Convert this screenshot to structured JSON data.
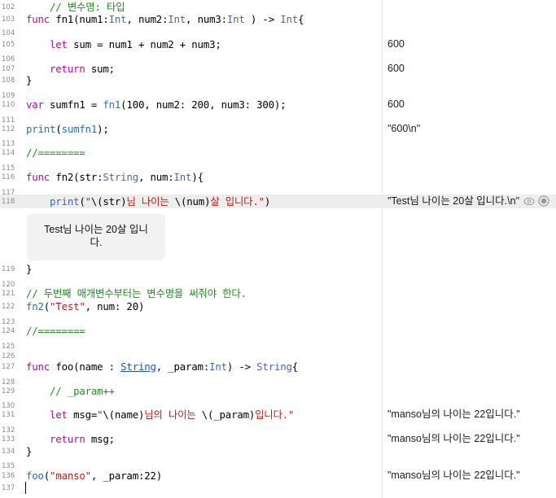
{
  "code_lines": [
    {
      "n": "102",
      "parts": [
        {
          "t": "    // 변수명: 타입",
          "c": "com"
        }
      ]
    },
    {
      "n": "103",
      "parts": [
        {
          "t": "func ",
          "c": "kw"
        },
        {
          "t": "fn1(num1:"
        },
        {
          "t": "Int",
          "c": "ty"
        },
        {
          "t": ", num2:"
        },
        {
          "t": "Int",
          "c": "ty"
        },
        {
          "t": ", num3:"
        },
        {
          "t": "Int",
          "c": "ty"
        },
        {
          "t": " ) -> "
        },
        {
          "t": "Int",
          "c": "ty"
        },
        {
          "t": "{"
        }
      ]
    },
    {
      "n": "104",
      "parts": []
    },
    {
      "n": "105",
      "parts": [
        {
          "t": "    let ",
          "c": "kw"
        },
        {
          "t": "sum = num1 + num2 + num3;"
        }
      ]
    },
    {
      "n": "106",
      "parts": []
    },
    {
      "n": "107",
      "parts": [
        {
          "t": "    return ",
          "c": "kw"
        },
        {
          "t": "sum;"
        }
      ]
    },
    {
      "n": "108",
      "parts": [
        {
          "t": "}"
        }
      ]
    },
    {
      "n": "109",
      "parts": []
    },
    {
      "n": "110",
      "parts": [
        {
          "t": "var ",
          "c": "kw"
        },
        {
          "t": "sumfn1 = "
        },
        {
          "t": "fn1",
          "c": "fn"
        },
        {
          "t": "(100, num2: 200, num3: 300);"
        }
      ]
    },
    {
      "n": "111",
      "parts": []
    },
    {
      "n": "112",
      "parts": [
        {
          "t": "print",
          "c": "fn"
        },
        {
          "t": "("
        },
        {
          "t": "sumfn1",
          "c": "fn"
        },
        {
          "t": ");"
        }
      ]
    },
    {
      "n": "113",
      "parts": []
    },
    {
      "n": "114",
      "parts": [
        {
          "t": "//========",
          "c": "com"
        }
      ]
    },
    {
      "n": "115",
      "parts": []
    },
    {
      "n": "116",
      "parts": [
        {
          "t": "func ",
          "c": "kw"
        },
        {
          "t": "fn2(str:"
        },
        {
          "t": "String",
          "c": "ty"
        },
        {
          "t": ", num:"
        },
        {
          "t": "Int",
          "c": "ty"
        },
        {
          "t": "){"
        }
      ]
    },
    {
      "n": "117",
      "parts": []
    },
    {
      "n": "118",
      "parts": [
        {
          "t": "    print",
          "c": "fn"
        },
        {
          "t": "("
        },
        {
          "t": "\"",
          "c": "str"
        },
        {
          "t": "\\(str)"
        },
        {
          "t": "님 나이는 ",
          "c": "str"
        },
        {
          "t": "\\(num)"
        },
        {
          "t": "살 입니다.\"",
          "c": "str"
        },
        {
          "t": ")"
        }
      ]
    },
    {
      "n": "119",
      "parts": [
        {
          "t": "}"
        }
      ]
    },
    {
      "n": "120",
      "parts": []
    },
    {
      "n": "121",
      "parts": [
        {
          "t": "// 두번째 매개변수부터는 변수명을 써줘야 한다.",
          "c": "com"
        }
      ]
    },
    {
      "n": "122",
      "parts": [
        {
          "t": "fn2",
          "c": "fn"
        },
        {
          "t": "("
        },
        {
          "t": "\"Test\"",
          "c": "str"
        },
        {
          "t": ", num: 20)"
        }
      ]
    },
    {
      "n": "123",
      "parts": []
    },
    {
      "n": "124",
      "parts": [
        {
          "t": "//========",
          "c": "com"
        }
      ]
    },
    {
      "n": "125",
      "parts": []
    },
    {
      "n": "126",
      "parts": []
    },
    {
      "n": "127",
      "parts": [
        {
          "t": "func ",
          "c": "kw"
        },
        {
          "t": "foo(name : "
        },
        {
          "t": "String",
          "c": "lnk"
        },
        {
          "t": ", _param:"
        },
        {
          "t": "Int",
          "c": "ty"
        },
        {
          "t": ") -> "
        },
        {
          "t": "String",
          "c": "ty"
        },
        {
          "t": "{"
        }
      ]
    },
    {
      "n": "128",
      "parts": []
    },
    {
      "n": "129",
      "parts": [
        {
          "t": "    // _param++",
          "c": "com"
        }
      ]
    },
    {
      "n": "130",
      "parts": []
    },
    {
      "n": "131",
      "parts": [
        {
          "t": "    let ",
          "c": "kw"
        },
        {
          "t": "msg="
        },
        {
          "t": "\"",
          "c": "str"
        },
        {
          "t": "\\(name)"
        },
        {
          "t": "님의 나이는 ",
          "c": "str"
        },
        {
          "t": "\\(_param)"
        },
        {
          "t": "입니다.\"",
          "c": "str"
        }
      ]
    },
    {
      "n": "132",
      "parts": []
    },
    {
      "n": "133",
      "parts": [
        {
          "t": "    return ",
          "c": "kw"
        },
        {
          "t": "msg;"
        }
      ]
    },
    {
      "n": "134",
      "parts": [
        {
          "t": "}"
        }
      ]
    },
    {
      "n": "135",
      "parts": []
    },
    {
      "n": "136",
      "parts": [
        {
          "t": "foo",
          "c": "fn"
        },
        {
          "t": "("
        },
        {
          "t": "\"manso\"",
          "c": "str"
        },
        {
          "t": ", _param:22)"
        }
      ]
    },
    {
      "n": "137",
      "parts": []
    }
  ],
  "results": [
    {
      "line": "105",
      "text": "600"
    },
    {
      "line": "107",
      "text": "600"
    },
    {
      "line": "110",
      "text": "600"
    },
    {
      "line": "112",
      "text": "\"600\\n\""
    },
    {
      "line": "118",
      "text": "\"Test님 나이는 20살 입니다.\\n\""
    },
    {
      "line": "131",
      "text": "\"manso님의 나이는 22입니다.\""
    },
    {
      "line": "133",
      "text": "\"manso님의 나이는 22입니다.\""
    },
    {
      "line": "136",
      "text": "\"manso님의 나이는 22입니다.\""
    }
  ],
  "inline_result": {
    "text": "Test님 나이는 20살 입니다."
  },
  "icons": {
    "quick_look": "eye-icon",
    "show_result": "circle-result-icon"
  }
}
